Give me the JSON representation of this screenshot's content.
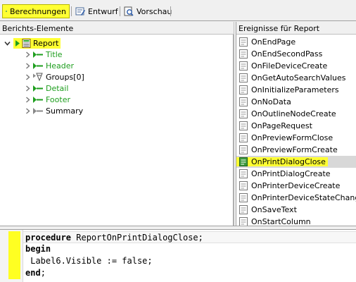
{
  "tabs": {
    "calc_label": "Berechnungen",
    "design_label": "Entwurf",
    "preview_label": "Vorschau"
  },
  "left_panel": {
    "title": "Berichts-Elemente"
  },
  "right_panel": {
    "title": "Ereignisse für Report"
  },
  "tree": {
    "root": "Report",
    "children": [
      {
        "label": "Title"
      },
      {
        "label": "Header"
      },
      {
        "label": "Groups[0]"
      },
      {
        "label": "Detail"
      },
      {
        "label": "Footer"
      },
      {
        "label": "Summary"
      }
    ]
  },
  "events": [
    {
      "label": "OnEndPage"
    },
    {
      "label": "OnEndSecondPass"
    },
    {
      "label": "OnFileDeviceCreate"
    },
    {
      "label": "OnGetAutoSearchValues"
    },
    {
      "label": "OnInitializeParameters"
    },
    {
      "label": "OnNoData"
    },
    {
      "label": "OnOutlineNodeCreate"
    },
    {
      "label": "OnPageRequest"
    },
    {
      "label": "OnPreviewFormClose"
    },
    {
      "label": "OnPreviewFormCreate"
    },
    {
      "label": "OnPrintDialogClose"
    },
    {
      "label": "OnPrintDialogCreate"
    },
    {
      "label": "OnPrinterDeviceCreate"
    },
    {
      "label": "OnPrinterDeviceStateChange"
    },
    {
      "label": "OnSaveText"
    },
    {
      "label": "OnStartColumn"
    }
  ],
  "selected_event": "OnPrintDialogClose",
  "code": {
    "line1_kw": "procedure",
    "line1_rest": " ReportOnPrintDialogClose;",
    "line2_kw": "begin",
    "line3": " Label6.Visible := false;",
    "line4_kw": "end",
    "line4_rest": ";"
  },
  "colors": {
    "highlight": "#ffff33",
    "tree_green": "#1e9e1e"
  }
}
